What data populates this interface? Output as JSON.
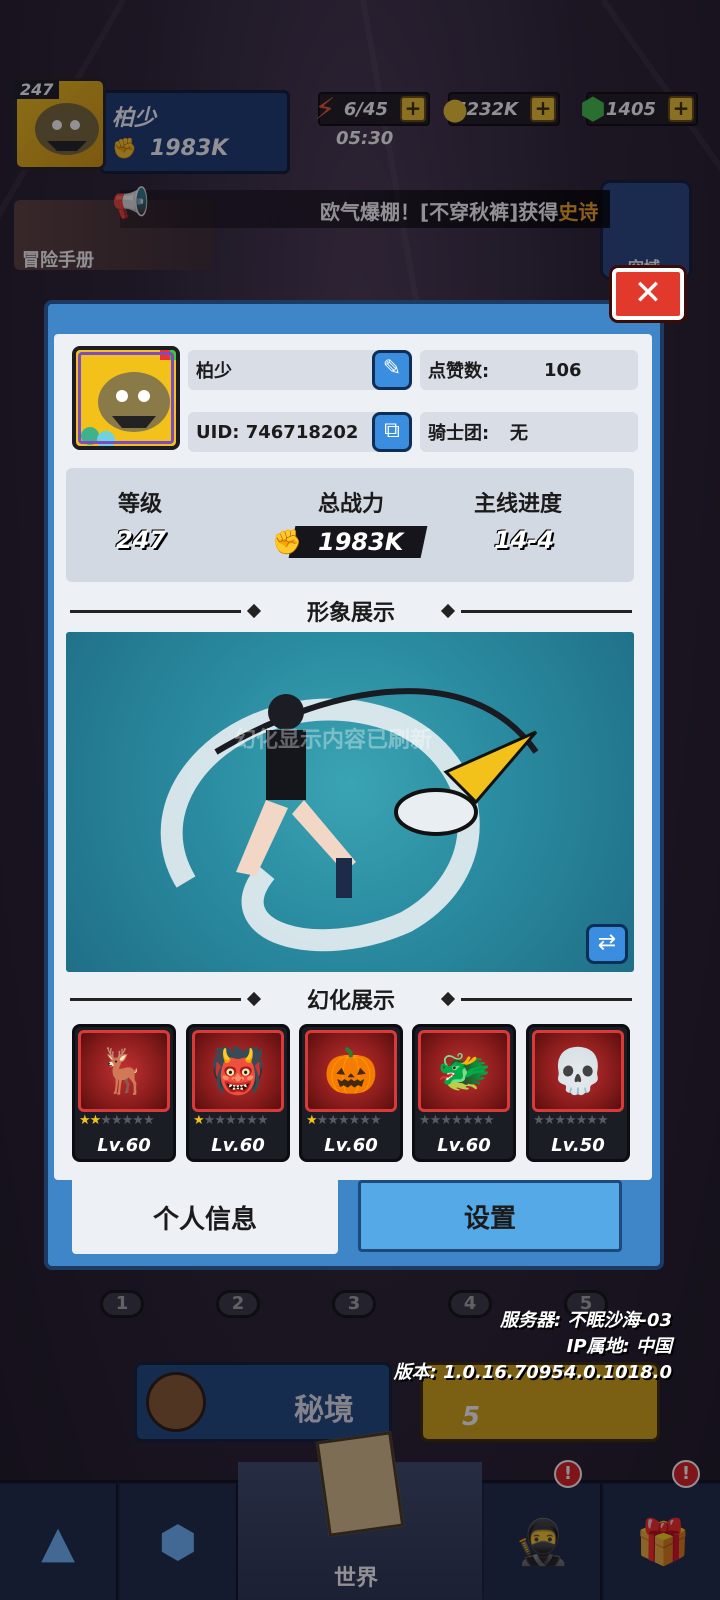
{
  "hud": {
    "level": "247",
    "name": "柏少",
    "power": "1983K",
    "energy": "6/45",
    "energy_timer": "05:30",
    "gold": "5232K",
    "gems": "1405",
    "plus": "+"
  },
  "ticker": {
    "text_prefix": "欧气爆棚！[不穿秋裤]获得",
    "text_highlight": "史诗"
  },
  "side": {
    "adventure_label": "冒险手册",
    "airspace_label": "空域"
  },
  "modal": {
    "close": "✕",
    "name": "柏少",
    "likes_label": "点赞数:",
    "likes_value": "106",
    "uid_label": "UID: 746718202",
    "guild_label": "骑士团:",
    "guild_value": "无",
    "stats": {
      "level_label": "等级",
      "level_value": "247",
      "power_label": "总战力",
      "power_value": "1983K",
      "progress_label": "主线进度",
      "progress_value": "14-4"
    },
    "section_image": "形象展示",
    "section_transform": "幻化展示",
    "watermark": "幻化显示内容已刷新",
    "pets": [
      {
        "lv": "Lv.60",
        "stars_on": 2,
        "icon": "deer-spirit-icon",
        "glyph": "🦌"
      },
      {
        "lv": "Lv.60",
        "stars_on": 1,
        "icon": "horned-demon-icon",
        "glyph": "👹"
      },
      {
        "lv": "Lv.60",
        "stars_on": 1,
        "icon": "pumpkin-monster-icon",
        "glyph": "🎃"
      },
      {
        "lv": "Lv.60",
        "stars_on": 0,
        "icon": "green-beast-icon",
        "glyph": "🐲"
      },
      {
        "lv": "Lv.50",
        "stars_on": 0,
        "icon": "skull-beast-icon",
        "glyph": "💀"
      }
    ],
    "tabs": {
      "profile": "个人信息",
      "settings": "设置"
    }
  },
  "server": {
    "server_line": "服务器: 不眠沙海-03",
    "ip_line": "IP属地: 中国",
    "version_line": "版本: 1.0.16.70954.0.1018.0"
  },
  "bottom": {
    "mijing": "秘境",
    "start_count": "5",
    "world": "世界",
    "stages": [
      "1",
      "2",
      "3",
      "4",
      "5"
    ],
    "badge": "!"
  },
  "colors": {
    "modal_blue": "#3f86c9",
    "close_red": "#e13a2c",
    "pet_frame_red": "#d83a3a",
    "star_gold": "#f3c21a",
    "showcase_teal": "#2a8ba0"
  }
}
